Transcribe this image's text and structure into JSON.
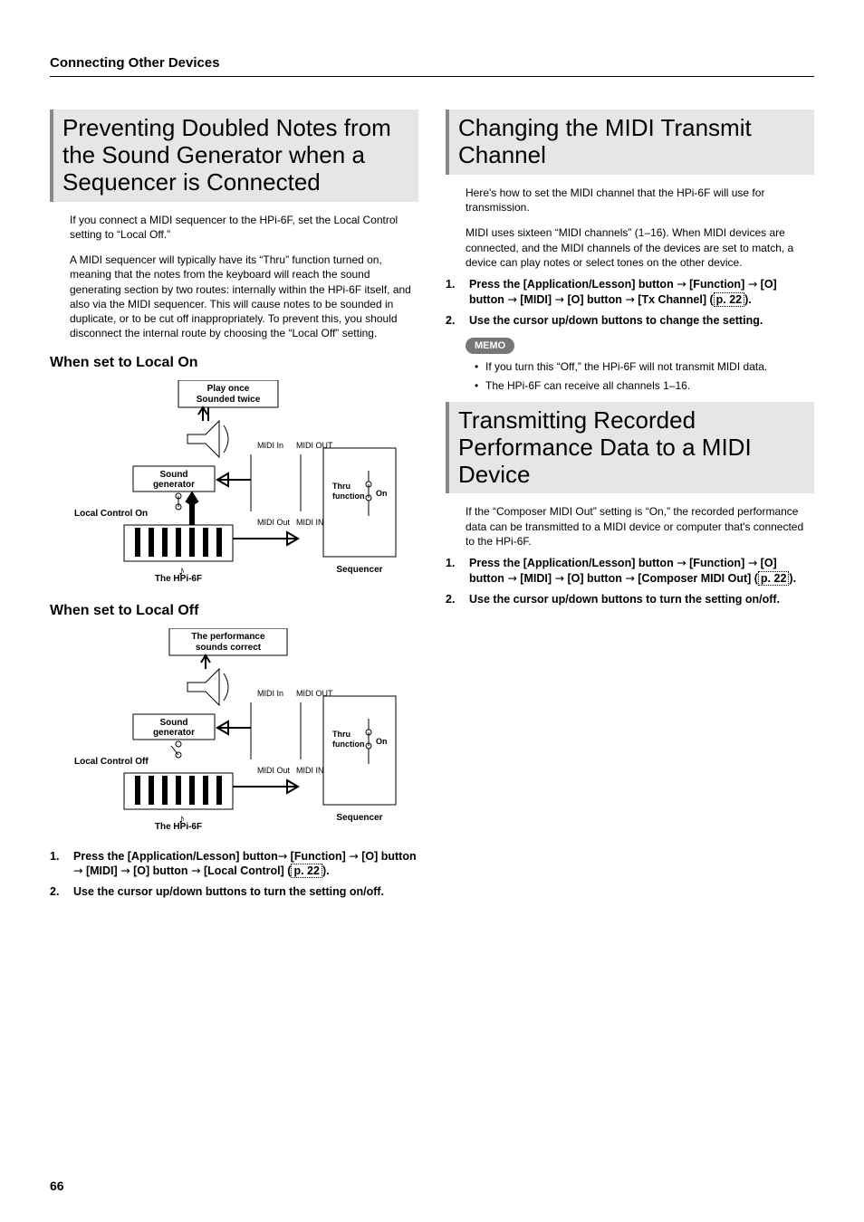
{
  "runningHead": "Connecting Other Devices",
  "pageNumber": "66",
  "left": {
    "h1": "Preventing Doubled Notes from the Sound Generator when a Sequencer is Connected",
    "para1": "If you connect a MIDI sequencer to the HPi-6F, set the Local Control setting to “Local Off.”",
    "para2": "A MIDI sequencer will typically have its “Thru” function turned on, meaning that the notes from the keyboard will reach the sound generating section by two routes: internally within the HPi-6F itself, and also via the MIDI sequencer. This will cause notes to be sounded in duplicate, or to be cut off inappropriately. To prevent this, you should disconnect the internal route by choosing the “Local Off” setting.",
    "h2a": "When set to Local On",
    "h2b": "When set to Local Off",
    "diagramA": {
      "noteBox1": "Play once",
      "noteBox2": "Sounded twice",
      "soundGen": "Sound generator",
      "localLabel": "Local Control On",
      "midiIn": "MIDI In",
      "midiOut": "MIDI OUT",
      "midiOut2": "MIDI Out",
      "midiIn2": "MIDI IN",
      "thru": "Thru function",
      "on": "On",
      "captionL": "The HPi-6F",
      "captionR": "Sequencer"
    },
    "diagramB": {
      "noteBox1": "The performance",
      "noteBox2": "sounds correct",
      "soundGen": "Sound generator",
      "localLabel": "Local Control Off",
      "midiIn": "MIDI In",
      "midiOut": "MIDI OUT",
      "midiOut2": "MIDI Out",
      "midiIn2": "MIDI IN",
      "thru": "Thru function",
      "on": "On",
      "captionL": "The HPi-6F",
      "captionR": "Sequencer"
    },
    "steps": [
      {
        "n": "1.",
        "t_pre": "Press the [Application/Lesson] button",
        "t_mid": " [Function] ",
        "t_mid2": " [O] button ",
        "t_mid3": " [MIDI] ",
        "t_mid4": " [O] button ",
        "t_end": " [Local Control] (",
        "ref": "p. 22",
        "close": ")."
      },
      {
        "n": "2.",
        "t": "Use the cursor up/down buttons to turn the setting on/off."
      }
    ]
  },
  "right": {
    "h1a": "Changing the MIDI Transmit Channel",
    "para1": "Here's how to set the MIDI channel that the HPi-6F will use for transmission.",
    "para2": "MIDI uses sixteen “MIDI channels” (1–16). When MIDI devices are connected, and the MIDI channels of the devices are set to match, a device can play notes or select tones on the other device.",
    "stepsA": [
      {
        "n": "1.",
        "t_pre": "Press the [Application/Lesson] button ",
        "t_mid": " [Function] ",
        "t_mid2": " [O] button ",
        "t_mid3": " [MIDI] ",
        "t_mid4": " [O] button ",
        "t_end": " [Tx Channel] (",
        "ref": "p. 22",
        "close": ")."
      },
      {
        "n": "2.",
        "t": "Use the cursor up/down buttons to change the setting."
      }
    ],
    "memoLabel": "MEMO",
    "memo": [
      "If you turn this “Off,” the HPi-6F will not transmit MIDI data.",
      "The HPi-6F can receive all channels 1–16."
    ],
    "h1b": "Transmitting Recorded Performance Data to a MIDI Device",
    "para3": "If the “Composer MIDI Out” setting is “On,” the recorded performance data can be transmitted to a MIDI device or computer that's connected to the HPi-6F.",
    "stepsB": [
      {
        "n": "1.",
        "t_pre": "Press the [Application/Lesson] button ",
        "t_mid": " [Function] ",
        "t_mid2": " [O] button ",
        "t_mid3": " [MIDI] ",
        "t_mid4": " [O] button ",
        "t_end": " [Composer MIDI Out] (",
        "ref": "p. 22",
        "close": ")."
      },
      {
        "n": "2.",
        "t": "Use the cursor up/down buttons to turn the setting on/off."
      }
    ]
  }
}
